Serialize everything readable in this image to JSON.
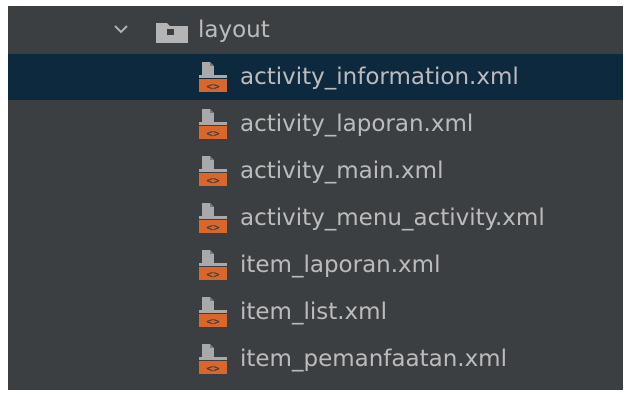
{
  "tree": {
    "folder": {
      "label": "layout",
      "expanded": true,
      "icon": "folder-icon",
      "chevron": "chevron-down-icon"
    },
    "files": [
      {
        "label": "activity_information.xml",
        "icon": "xml-layout-file-icon",
        "selected": true
      },
      {
        "label": "activity_laporan.xml",
        "icon": "xml-layout-file-icon",
        "selected": false
      },
      {
        "label": "activity_main.xml",
        "icon": "xml-layout-file-icon",
        "selected": false
      },
      {
        "label": "activity_menu_activity.xml",
        "icon": "xml-layout-file-icon",
        "selected": false
      },
      {
        "label": "item_laporan.xml",
        "icon": "xml-layout-file-icon",
        "selected": false
      },
      {
        "label": "item_list.xml",
        "icon": "xml-layout-file-icon",
        "selected": false
      },
      {
        "label": "item_pemanfaatan.xml",
        "icon": "xml-layout-file-icon",
        "selected": false
      }
    ]
  },
  "colors": {
    "panel_background": "#3c3f41",
    "selection_background": "#0d293e",
    "text": "#bbbbbb",
    "folder_icon": "#b5b5b5",
    "xml_icon_accent": "#d9662b"
  }
}
